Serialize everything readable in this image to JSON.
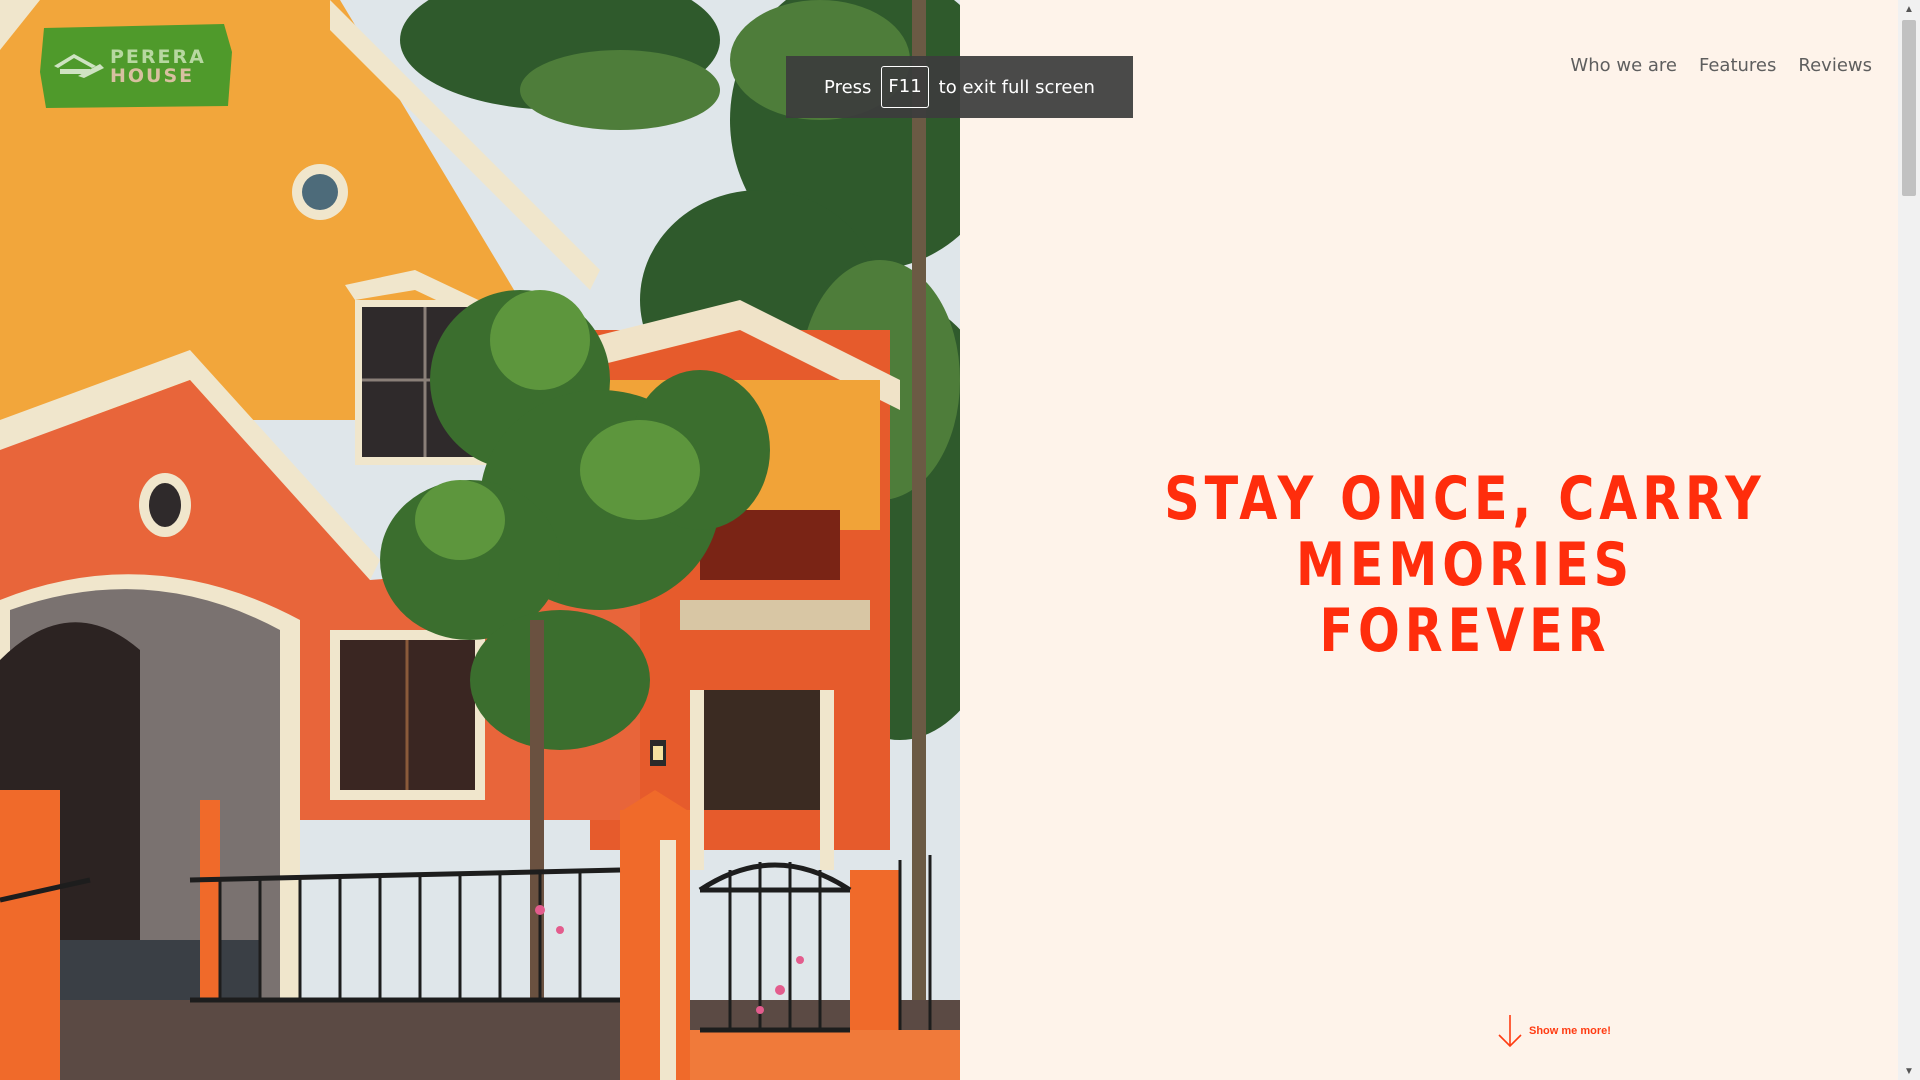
{
  "brand": {
    "line1": "PERERA",
    "line2": "HOUSE"
  },
  "toast": {
    "before": "Press",
    "key": "F11",
    "after": "to exit full screen"
  },
  "nav": {
    "items": [
      {
        "label": "Who we are"
      },
      {
        "label": "Features"
      },
      {
        "label": "Reviews"
      }
    ]
  },
  "hero": {
    "headline_line1": "STAY ONCE, CARRY MEMORIES",
    "headline_line2": "FOREVER",
    "show_more": "Show me more!"
  },
  "colors": {
    "accent": "#ff2d0c",
    "background": "#fef3ea",
    "logo_green": "#4f9a2b",
    "nav_text": "#5e5e5e"
  }
}
